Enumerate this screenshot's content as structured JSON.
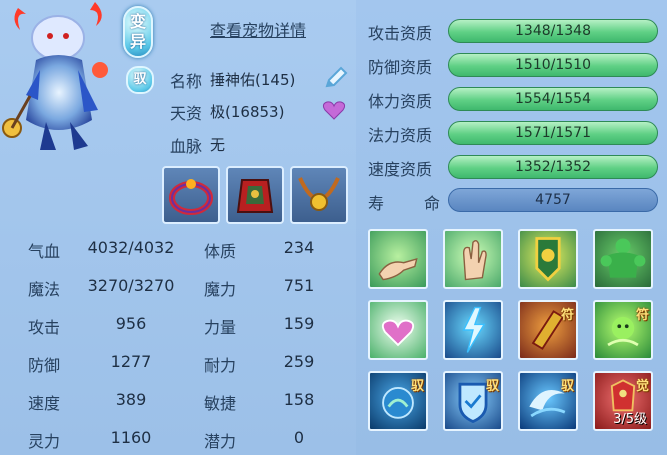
{
  "pet": {
    "mutation_badge": "变异",
    "ride_badge": "驭",
    "details_link": "查看宠物详情",
    "name_label": "名称",
    "name_value": "捶神佑(145)",
    "talent_label": "天资",
    "talent_value": "极(16853)",
    "bloodline_label": "血脉",
    "bloodline_value": "无"
  },
  "items": [
    {
      "name": "bracelet-item-icon"
    },
    {
      "name": "armor-item-icon"
    },
    {
      "name": "necklace-item-icon"
    }
  ],
  "stats": [
    {
      "label": "气血",
      "value": "4032/4032",
      "label2": "体质",
      "value2": "234"
    },
    {
      "label": "魔法",
      "value": "3270/3270",
      "label2": "魔力",
      "value2": "751"
    },
    {
      "label": "攻击",
      "value": "956",
      "label2": "力量",
      "value2": "159"
    },
    {
      "label": "防御",
      "value": "1277",
      "label2": "耐力",
      "value2": "259"
    },
    {
      "label": "速度",
      "value": "389",
      "label2": "敏捷",
      "value2": "158"
    },
    {
      "label": "灵力",
      "value": "1160",
      "label2": "潜力",
      "value2": "0"
    }
  ],
  "aptitudes": [
    {
      "label": "攻击资质",
      "value": "1348/1348"
    },
    {
      "label": "防御资质",
      "value": "1510/1510"
    },
    {
      "label": "体力资质",
      "value": "1554/1554"
    },
    {
      "label": "法力资质",
      "value": "1571/1571"
    },
    {
      "label": "速度资质",
      "value": "1352/1352"
    }
  ],
  "life": {
    "label_a": "寿",
    "label_b": "命",
    "value": "4757"
  },
  "skills": [
    {
      "icon": "pointing-hand-skill-icon",
      "tag": ""
    },
    {
      "icon": "palm-skill-icon",
      "tag": ""
    },
    {
      "icon": "shield-banner-skill-icon",
      "tag": ""
    },
    {
      "icon": "green-giant-skill-icon",
      "tag": ""
    },
    {
      "icon": "heart-skill-icon",
      "tag": ""
    },
    {
      "icon": "lightning-skill-icon",
      "tag": ""
    },
    {
      "icon": "talisman-skill-icon",
      "tag": "符"
    },
    {
      "icon": "spirit-skill-icon",
      "tag": "符"
    },
    {
      "icon": "orb-skill-icon",
      "tag": "驭"
    },
    {
      "icon": "shield-skill-icon",
      "tag": "驭"
    },
    {
      "icon": "wave-skill-icon",
      "tag": "驭"
    },
    {
      "icon": "awaken-skill-icon",
      "tag": "觉",
      "level": "3/5级"
    }
  ],
  "colors": {
    "aptitude_bar": "#5fd085",
    "life_bar": "#5a86c0",
    "panel": "#9dc2ea"
  }
}
